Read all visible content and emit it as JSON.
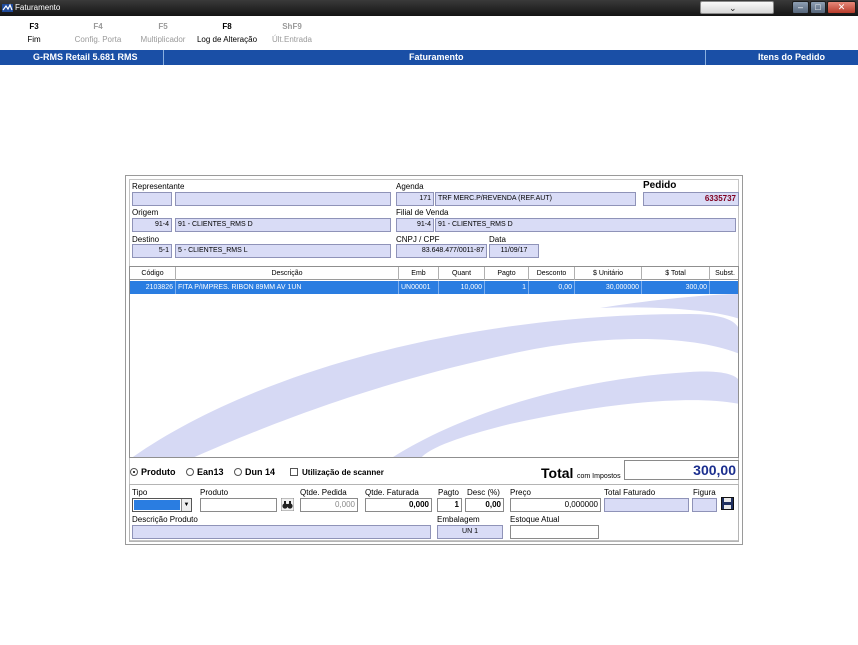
{
  "window": {
    "title": "Faturamento"
  },
  "toolbar": {
    "keys": [
      {
        "key": "F3",
        "label": "Fim"
      },
      {
        "key": "F4",
        "label": "Config. Porta"
      },
      {
        "key": "F5",
        "label": "Multiplicador"
      },
      {
        "key": "F8",
        "label": "Log de Alteração"
      },
      {
        "key": "ShF9",
        "label": "Últ.Entrada"
      }
    ]
  },
  "header_bar": {
    "app": "G-RMS Retail 5.681 RMS",
    "module": "Faturamento",
    "section": "Itens do Pedido"
  },
  "form": {
    "representante": {
      "label": "Representante",
      "code": "",
      "name": ""
    },
    "agenda": {
      "label": "Agenda",
      "code": "171",
      "name": "TRF MERC.P/REVENDA (REF.AUT)"
    },
    "pedido": {
      "label": "Pedido",
      "value": "6335737"
    },
    "origem": {
      "label": "Origem",
      "code": "91-4",
      "name": "91 - CLIENTES_RMS    D"
    },
    "filial": {
      "label": "Filial de Venda",
      "code": "91-4",
      "name": "91 - CLIENTES_RMS    D"
    },
    "destino": {
      "label": "Destino",
      "code": "5-1",
      "name": "5 - CLIENTES_RMS    L"
    },
    "cnpj": {
      "label": "CNPJ / CPF",
      "value": "83.648.477/0011-87"
    },
    "data": {
      "label": "Data",
      "value": "11/09/17"
    }
  },
  "grid": {
    "columns": [
      "Código",
      "Descrição",
      "Emb",
      "Quant",
      "Pagto",
      "Desconto",
      "$ Unitário",
      "$ Total",
      "Subst."
    ],
    "rows": [
      {
        "codigo": "2103826",
        "descricao": "FITA P/IMPRES. RIBON 89MM       AV   1UN",
        "emb": "UN00001",
        "quant": "10,000",
        "pagto": "1",
        "desconto": "0,00",
        "unitario": "30,000000",
        "total": "300,00",
        "subst": ""
      }
    ]
  },
  "search_mode": {
    "options": [
      "Produto",
      "Ean13",
      "Dun 14"
    ],
    "selected": "Produto",
    "scanner_label": "Utilização de scanner"
  },
  "total": {
    "label": "Total",
    "sub": "com Impostos",
    "value": "300,00"
  },
  "entry": {
    "tipo_label": "Tipo",
    "produto_label": "Produto",
    "qtde_pedida_label": "Qtde. Pedida",
    "qtde_pedida": "0,000",
    "qtde_faturada_label": "Qtde. Faturada",
    "qtde_faturada": "0,000",
    "pagto_label": "Pagto",
    "pagto": "1",
    "desc_label": "Desc (%)",
    "desc": "0,00",
    "preco_label": "Preço",
    "preco": "0,000000",
    "total_faturado_label": "Total Faturado",
    "figura_label": "Figura",
    "descricao_produto_label": "Descrição Produto",
    "embalagem_label": "Embalagem",
    "embalagem": "UN   1",
    "estoque_label": "Estoque Atual"
  },
  "colors": {
    "header_blue": "#1a4fa6",
    "field_lavender": "#d9dcf6",
    "selection_blue": "#2a7de1",
    "pedido_red": "#800020",
    "total_blue": "#1c2f8f"
  }
}
